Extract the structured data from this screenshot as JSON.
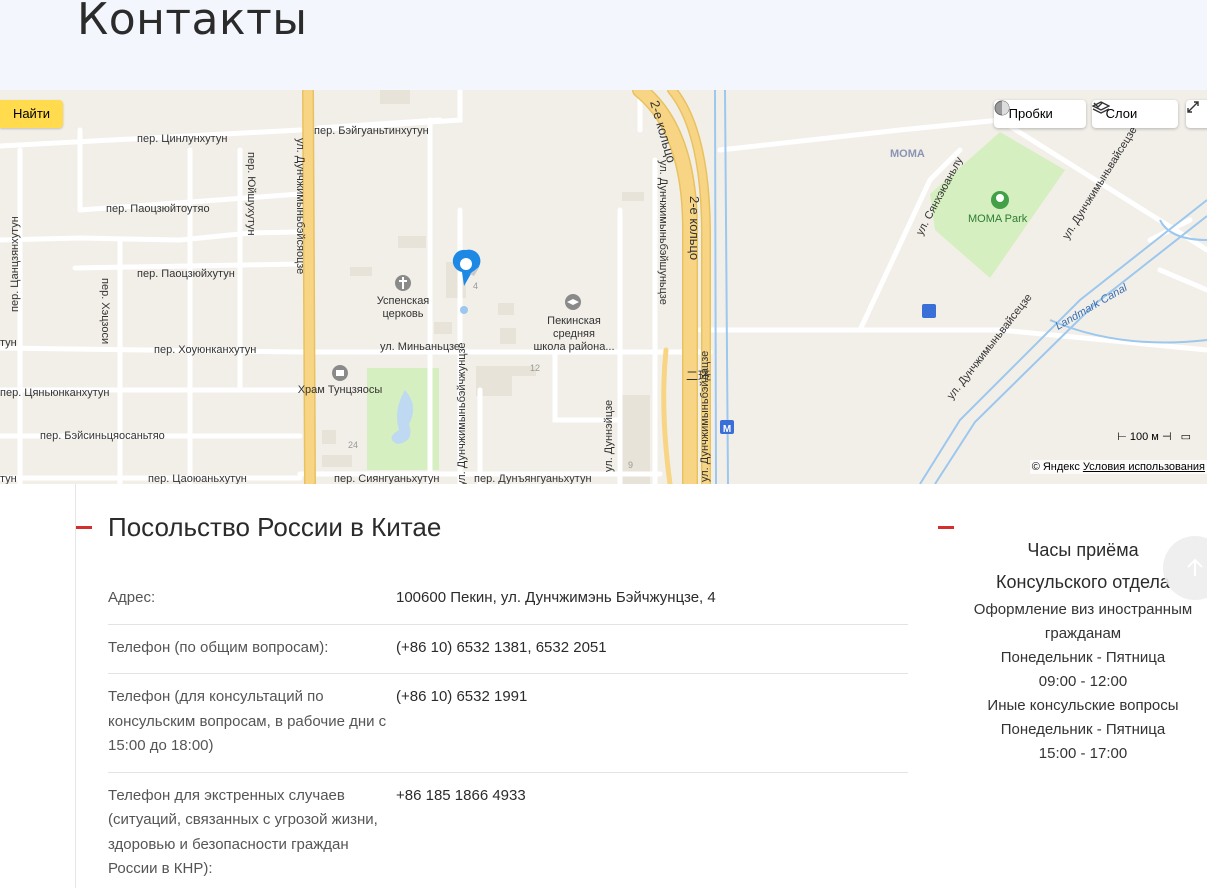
{
  "page": {
    "title": "Контакты"
  },
  "map": {
    "find_label": "Найти",
    "traffic_label": "Пробки",
    "layers_label": "Слои",
    "scale_label": "100 м",
    "copyright": "© Яндекс",
    "terms_label": "Условия использования",
    "labels": {
      "moma": "MOMA",
      "moma_park": "MOMA Park",
      "landmark_canal": "Landmark Canal",
      "uspenskaya": [
        "Успенская",
        "церковь"
      ],
      "school": [
        "Пекинская",
        "средняя",
        "школа района..."
      ],
      "temple": "Храм Тунцзяосы",
      "tsinluhutun": "пер. Цинлунхутун",
      "beyguantinhutun": "пер. Бэйгуаньтинхутун",
      "paotszyoutoutyao": "пер. Паоцзюйтоутяо",
      "paotszyouhutun": "пер. Паоцзюйхутун",
      "yushuhutun": "пер. Юйшухутун",
      "houyunkanhutun": "пер. Хоуюнканхутун",
      "minyantsze": "ул. Миньаньцзе",
      "tsyanyunkanhutun": "пер. Цяньюнканхутун",
      "beysinyaosantyao": "пер. Бэйсиньцяосаньтяо",
      "tsaoyuanhutun": "пер. Цаоюаньхутун",
      "siyanguanhutun": "пер. Сиянгуаньхутун",
      "dunyanguanhutun": "пер. Дунъянгуаньхутун",
      "huashi": "пер. Хэцзоси",
      "tsantsyan": "пер. Цанцзянхутун",
      "dunchzhimen_beysyao": "ул. Дунчжимыньбэйсяоцзе",
      "dunchzhimen_beyzhun": "ул. Дунчжимыньбэйчжунцзе",
      "dunchzhimen_beyshun": "ул. Дунчжимыньбэйшуньцзе",
      "dunchzhimen_beyda": "ул. Дунчжимыньбэйдацзе",
      "dunchzhimen_wai_1": "ул. Дунчжимыньвайсецзе",
      "dunchzhimen_wai_2": "ул. Дунчжимыньвайсецзе",
      "dunnyaycze": "ул. Дуннэйцзе",
      "sanzhuanlu": "ул. Сянхэюаньлу",
      "ring_1": "2-е кольцо",
      "ring_2": "2-е кольцо",
      "num_4": "4",
      "num_12": "12",
      "num_24": "24",
      "num_9": "9",
      "lat_24": "24"
    }
  },
  "embassy": {
    "title": "Посольство России в Китае",
    "rows": [
      {
        "label": "Адрес:",
        "value": "100600 Пекин, ул. Дунчжимэнь Бэйчжунцзе, 4"
      },
      {
        "label": "Телефон (по общим вопросам):",
        "value": "(+86 10) 6532 1381, 6532 2051"
      },
      {
        "label": "Телефон (для консультаций по консульским вопросам, в рабочие дни с 15:00 до 18:00)",
        "value": "(+86 10) 6532 1991"
      },
      {
        "label": "Телефон для экстренных случаев (ситуаций, связанных с угрозой жизни, здоровью и безопасности граждан России в КНР):",
        "value": "+86 185 1866 4933"
      }
    ]
  },
  "hours": {
    "title_1": "Часы приёма",
    "title_2": "Консульского отдела",
    "lines": [
      "Оформление виз иностранным",
      "гражданам",
      "Понедельник - Пятница",
      "09:00 - 12:00",
      "Иные консульские вопросы",
      "Понедельник - Пятница",
      "15:00 - 17:00"
    ]
  },
  "colors": {
    "accent": "#d32f2f",
    "hero_bg": "#f3f6fc",
    "map_bg": "#f2efe9",
    "road_yellow": "#f7d584",
    "park_green": "#d5efc0"
  }
}
